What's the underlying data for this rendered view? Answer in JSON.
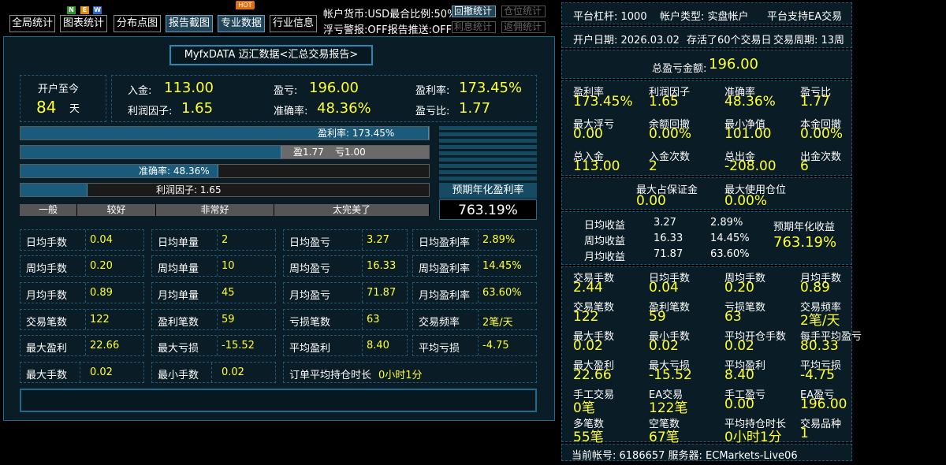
{
  "toolbar": {
    "buttons": [
      {
        "label": "全局统计"
      },
      {
        "label": "图表统计"
      },
      {
        "label": "分布点图"
      },
      {
        "label": "报告截图"
      },
      {
        "label": "专业数据"
      },
      {
        "label": "行业信息"
      }
    ],
    "new_badge": [
      "N",
      "E",
      "W"
    ],
    "hot_badge": "HOT",
    "currency_text": "帐户货币:USD最合比例:50%",
    "alert_text": "浮亏警报:OFF报告推送:OFF",
    "small_buttons": [
      {
        "label": "回撤统计"
      },
      {
        "label": "仓位统计"
      },
      {
        "label": "利息统计"
      },
      {
        "label": "返佣统计"
      }
    ]
  },
  "main": {
    "title": "MyfxDATA 迈汇数据<汇总交易报告>",
    "open_days": {
      "label": "开户至今",
      "value": "84",
      "unit": "天"
    },
    "summary": {
      "deposit_label": "入金:",
      "deposit_value": "113.00",
      "pl_label": "盈亏:",
      "pl_value": "196.00",
      "profit_rate_label": "盈利率:",
      "profit_rate_value": "173.45%",
      "profit_factor_label": "利润因子:",
      "profit_factor_value": "1.65",
      "accuracy_label": "准确率:",
      "accuracy_value": "48.36%",
      "pl_ratio_label": "盈亏比:",
      "pl_ratio_value": "1.77"
    },
    "bars": {
      "profit_rate_text": "盈利率: 173.45%",
      "profit_rate_fill": 1.0,
      "win_text": "盈1.77",
      "loss_text": "亏1.00",
      "win_fill": 0.639,
      "accuracy_text": "准确率: 48.36%",
      "accuracy_fill": 0.4836,
      "profit_factor_text": "利润因子: 1.65",
      "profit_factor_fill": 0.165
    },
    "grades": [
      "一般",
      "较好",
      "非常好",
      "太完美了"
    ],
    "annual_label": "预期年化盈利率",
    "annual_value": "763.19%",
    "cells": [
      [
        {
          "k": "日均手数",
          "v": "0.04"
        },
        {
          "k": "日均单量",
          "v": "2"
        },
        {
          "k": "日均盈亏",
          "v": "3.27"
        },
        {
          "k": "日均盈利率",
          "v": "2.89%"
        }
      ],
      [
        {
          "k": "周均手数",
          "v": "0.20"
        },
        {
          "k": "周均单量",
          "v": "10"
        },
        {
          "k": "周均盈亏",
          "v": "16.33"
        },
        {
          "k": "周均盈利率",
          "v": "14.45%"
        }
      ],
      [
        {
          "k": "月均手数",
          "v": "0.89"
        },
        {
          "k": "月均单量",
          "v": "45"
        },
        {
          "k": "月均盈亏",
          "v": "71.87"
        },
        {
          "k": "月均盈利率",
          "v": "63.60%"
        }
      ],
      [
        {
          "k": "交易笔数",
          "v": "122"
        },
        {
          "k": "盈利笔数",
          "v": "59"
        },
        {
          "k": "亏损笔数",
          "v": "63"
        },
        {
          "k": "交易频率",
          "v": "2笔/天"
        }
      ],
      [
        {
          "k": "最大盈利",
          "v": "22.66"
        },
        {
          "k": "最大亏损",
          "v": "-15.52"
        },
        {
          "k": "平均盈利",
          "v": "8.40"
        },
        {
          "k": "平均亏损",
          "v": "-4.75"
        }
      ]
    ],
    "last_row": {
      "max_lots_k": "最大手数",
      "max_lots_v": "0.02",
      "min_lots_k": "最小手数",
      "min_lots_v": "0.02",
      "hold_k": "订单平均持仓时长",
      "hold_v": "0小时1分"
    }
  },
  "right": {
    "row1": {
      "leverage": "平台杠杆: 1000",
      "account_type": "帐户类型: 实盘帐户",
      "ea": "平台支持EA交易"
    },
    "row2": {
      "open_date": "开户日期: 2026.03.02",
      "survived": "存活了60个交易日",
      "cycle": "交易周期: 13周"
    },
    "total_pl_label": "总盈亏金额:",
    "total_pl_value": "196.00",
    "grid1": [
      {
        "k": "盈利率",
        "v": "173.45%"
      },
      {
        "k": "利润因子",
        "v": "1.65"
      },
      {
        "k": "准确率",
        "v": "48.36%"
      },
      {
        "k": "盈亏比",
        "v": "1.77"
      },
      {
        "k": "最大浮亏",
        "v": "0.00"
      },
      {
        "k": "余额回撤",
        "v": "0.00%"
      },
      {
        "k": "最小净值",
        "v": "101.00"
      },
      {
        "k": "本金回撤",
        "v": "0.00%"
      },
      {
        "k": "总入金",
        "v": "113.00"
      },
      {
        "k": "入金次数",
        "v": "2"
      },
      {
        "k": "总出金",
        "v": "-208.00"
      },
      {
        "k": "出金次数",
        "v": "6"
      }
    ],
    "margin": {
      "k": "最大占保证金",
      "v": "0.00"
    },
    "position": {
      "k": "最大使用仓位",
      "v": "0.00%"
    },
    "avg": {
      "day_k": "日均收益",
      "day_v": "3.27",
      "day_p": "2.89%",
      "week_k": "周均收益",
      "week_v": "16.33",
      "week_p": "14.45%",
      "month_k": "月均收益",
      "month_v": "71.87",
      "month_p": "63.60%",
      "annual_k": "预期年化收益",
      "annual_v": "763.19%"
    },
    "grid2": [
      {
        "k": "交易手数",
        "v": "2.44"
      },
      {
        "k": "日均手数",
        "v": "0.04"
      },
      {
        "k": "周均手数",
        "v": "0.20"
      },
      {
        "k": "月均手数",
        "v": "0.89"
      },
      {
        "k": "交易笔数",
        "v": "122"
      },
      {
        "k": "盈利笔数",
        "v": "59"
      },
      {
        "k": "亏损笔数",
        "v": "63"
      },
      {
        "k": "交易频率",
        "v": "2笔/天"
      },
      {
        "k": "最大手数",
        "v": "0.02"
      },
      {
        "k": "最小手数",
        "v": "0.02"
      },
      {
        "k": "平均开仓手数",
        "v": "0.02"
      },
      {
        "k": "每手平均盈亏",
        "v": "80.33"
      },
      {
        "k": "最大盈利",
        "v": "22.66"
      },
      {
        "k": "最大亏损",
        "v": "-15.52"
      },
      {
        "k": "平均盈利",
        "v": "8.40"
      },
      {
        "k": "平均亏损",
        "v": "-4.75"
      },
      {
        "k": "手工交易",
        "v": "0笔"
      },
      {
        "k": "EA交易",
        "v": "122笔"
      },
      {
        "k": "手工盈亏",
        "v": "0.00"
      },
      {
        "k": "EA盈亏",
        "v": "196.00"
      },
      {
        "k": "多笔数",
        "v": "55笔"
      },
      {
        "k": "空笔数",
        "v": "67笔"
      },
      {
        "k": "平均持仓时长",
        "v": "0小时1分"
      },
      {
        "k": "交易品种",
        "v": "1"
      }
    ],
    "footer": "当前帐号: 6186657 服务器: ECMarkets-Live06"
  }
}
